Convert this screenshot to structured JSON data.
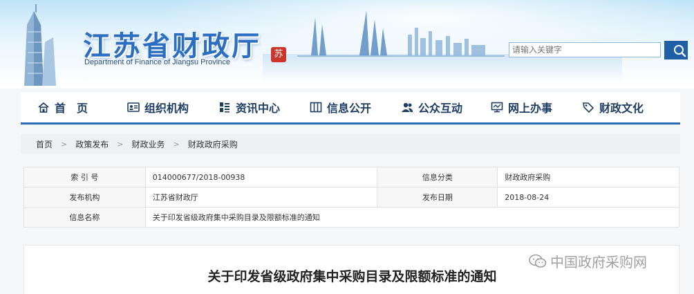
{
  "header": {
    "title_cn": "江苏省财政厅",
    "title_en": "Department of Finance of Jiangsu Province",
    "seal_char": "苏",
    "search_placeholder": "请输入关键字"
  },
  "nav": {
    "items": [
      {
        "label": "首　页",
        "icon": "home-icon"
      },
      {
        "label": "组织机构",
        "icon": "id-card-icon"
      },
      {
        "label": "资讯中心",
        "icon": "list-icon"
      },
      {
        "label": "信息公开",
        "icon": "columns-icon"
      },
      {
        "label": "公众互动",
        "icon": "users-icon"
      },
      {
        "label": "网上办事",
        "icon": "monitor-icon"
      },
      {
        "label": "财政文化",
        "icon": "tag-icon"
      }
    ],
    "accent": "#2b6cb7"
  },
  "breadcrumb": [
    "首页",
    "政策发布",
    "财政业务",
    "财政政府采购"
  ],
  "meta": {
    "index_label": "索 引 号",
    "index_value": "014000677/2018-00938",
    "category_label": "信息分类",
    "category_value": "财政政府采购",
    "publisher_label": "发布机构",
    "publisher_value": "江苏省财政厅",
    "date_label": "发布日期",
    "date_value": "2018-08-24",
    "name_label": "信息名称",
    "name_value": "关于印发省级政府集中采购目录及限额标准的通知"
  },
  "article": {
    "title": "关于印发省级政府集中采购目录及限额标准的通知"
  },
  "watermark": {
    "text": "中国政府采购网"
  }
}
